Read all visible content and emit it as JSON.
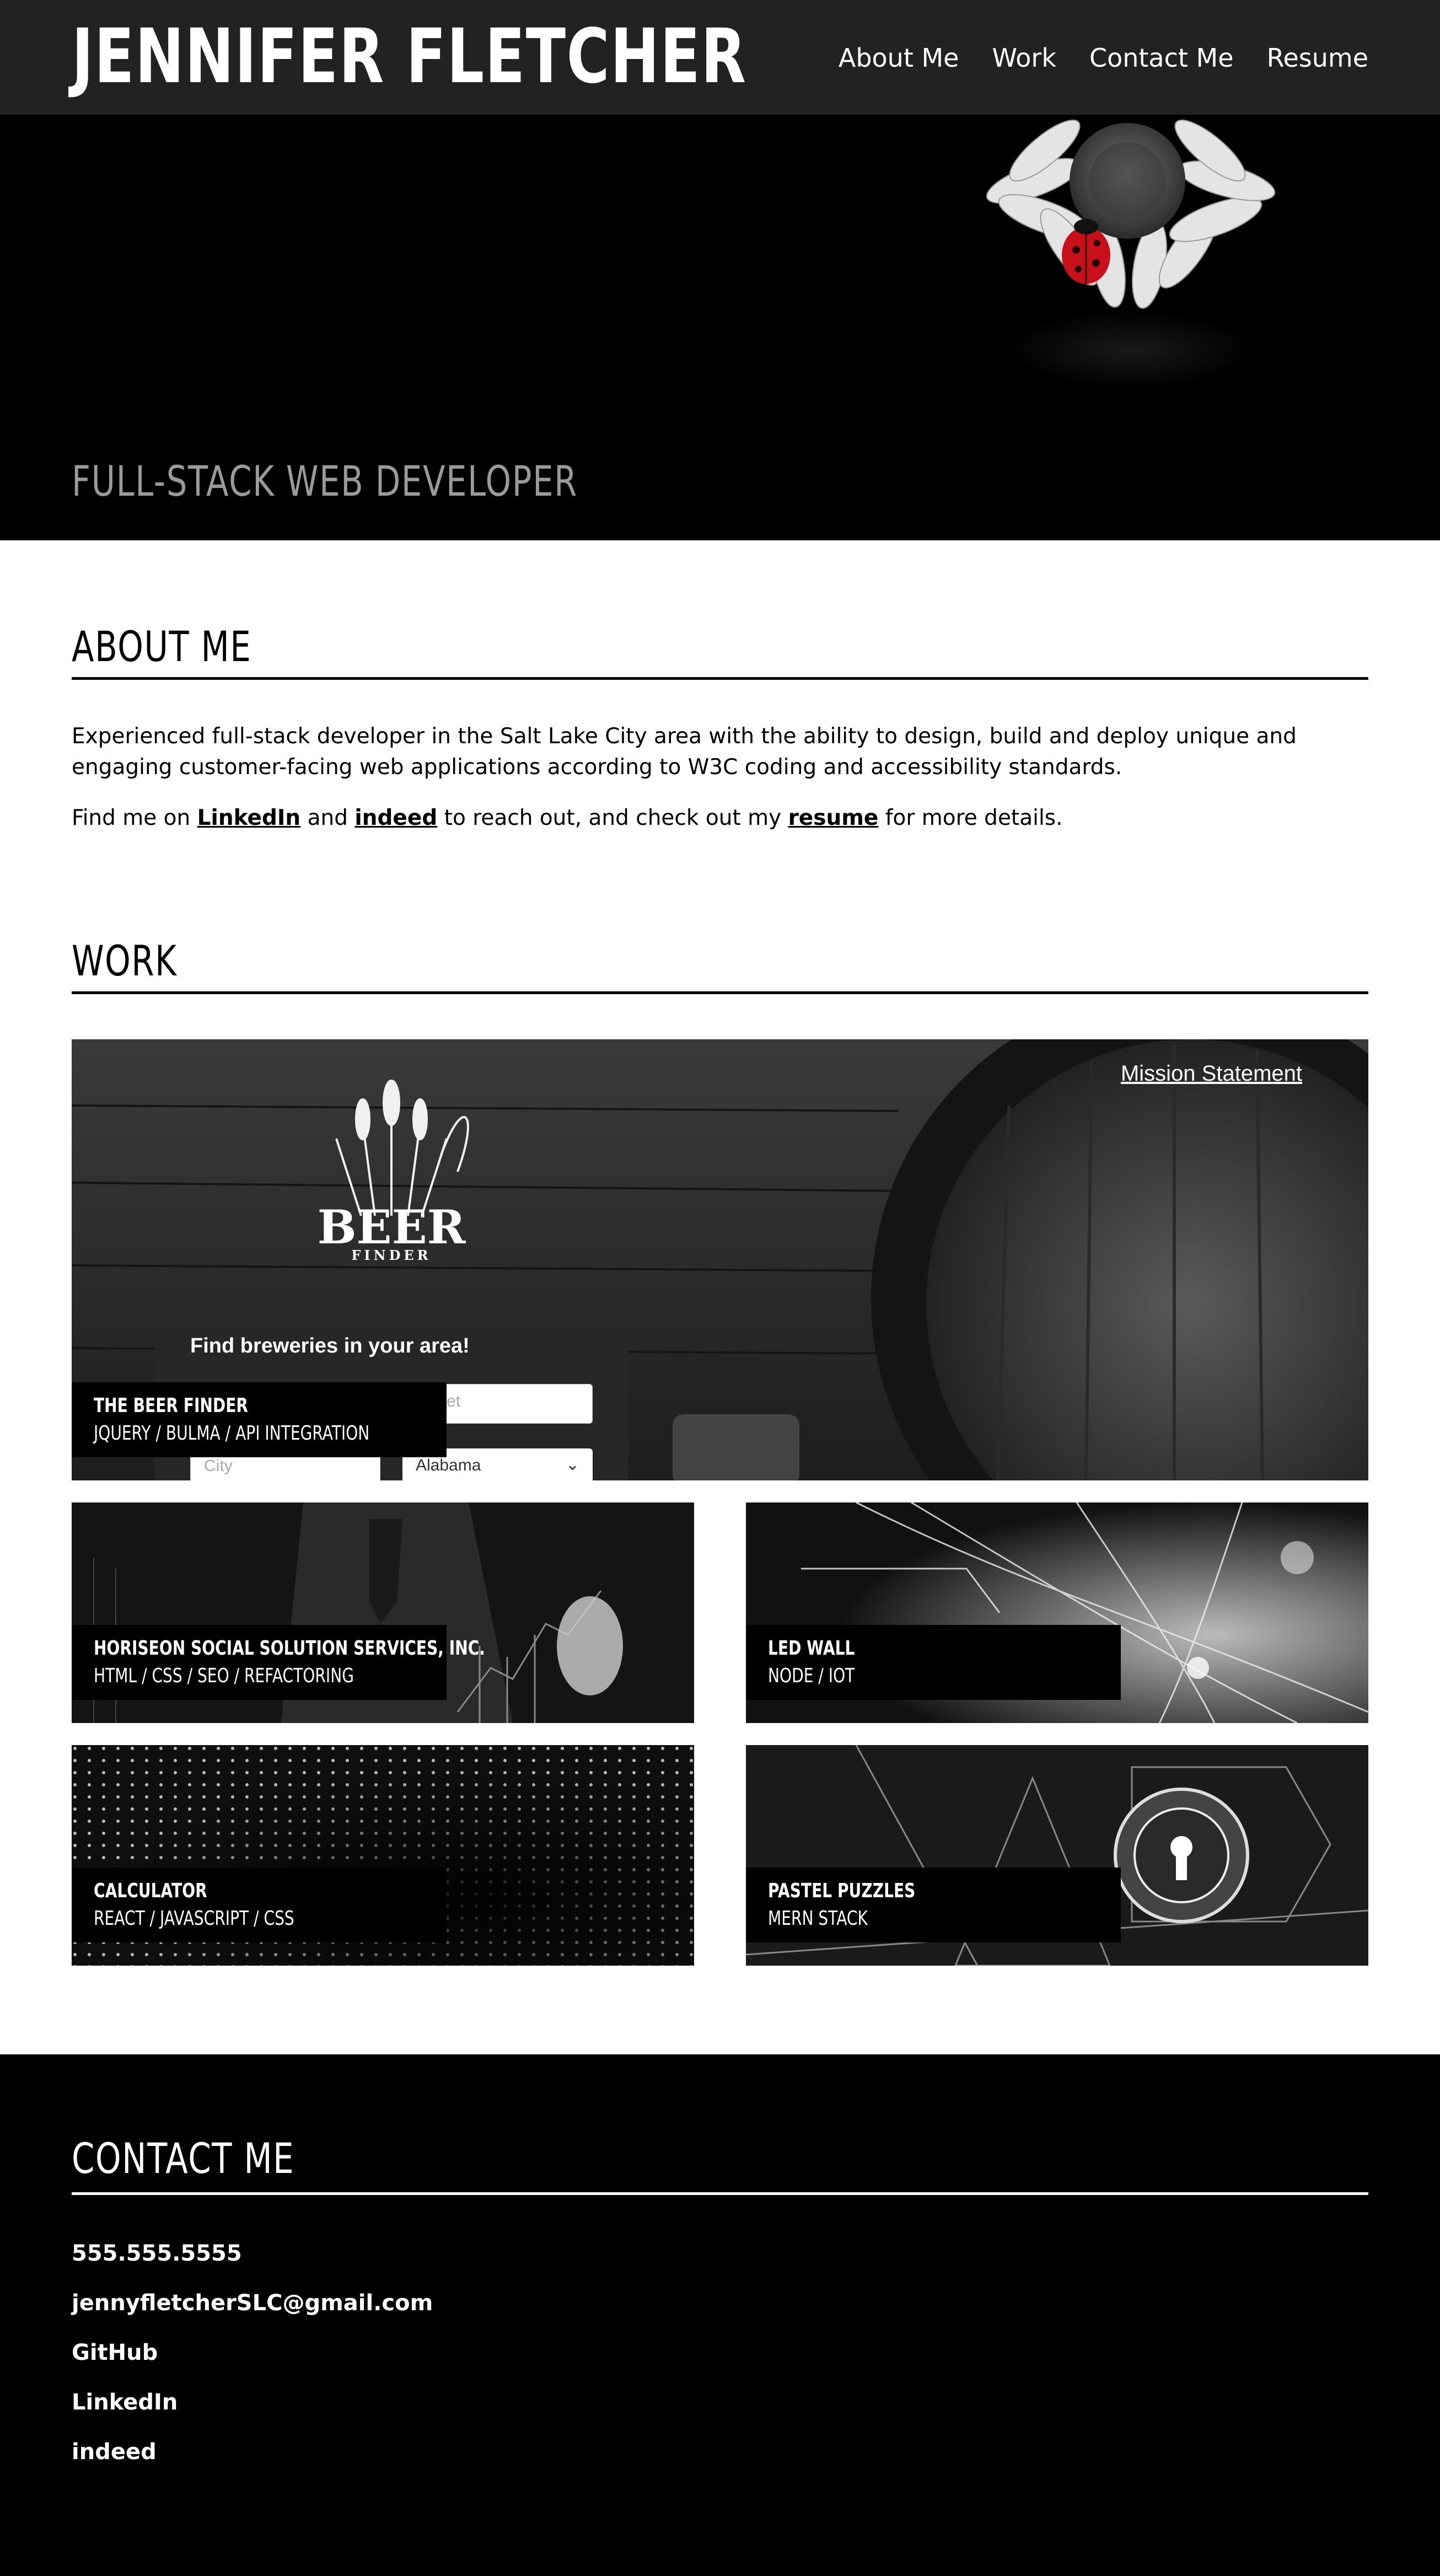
{
  "header": {
    "brand": "JENNIFER FLETCHER",
    "nav": [
      "About Me",
      "Work",
      "Contact Me",
      "Resume"
    ]
  },
  "hero": {
    "subtitle": "FULL-STACK WEB DEVELOPER"
  },
  "about": {
    "heading": "ABOUT ME",
    "paragraph1": "Experienced full-stack developer in the Salt Lake City area with the ability to design, build and deploy unique and engaging customer-facing web applications according to W3C coding and accessibility standards.",
    "p2_prefix": "Find me on ",
    "p2_link1": "LinkedIn",
    "p2_and": " and ",
    "p2_link2": "indeed",
    "p2_middle": " to reach out, and check out my ",
    "p2_link3": "resume",
    "p2_suffix": " for more details."
  },
  "work": {
    "heading": "WORK",
    "featured": {
      "title": "THE BEER FINDER",
      "tech": "JQUERY / BULMA / API INTEGRATION",
      "mission_link": "Mission Statement",
      "logo_text": "BEER",
      "logo_sub": "FINDER",
      "panel_title": "Find breweries in your area!",
      "street_placeholder": "Street",
      "city_placeholder": "City",
      "state_selected": "Alabama"
    },
    "projects": [
      {
        "title": "HORISEON SOCIAL SOLUTION SERVICES, INC.",
        "tech": "HTML / CSS / SEO / REFACTORING"
      },
      {
        "title": "LED WALL",
        "tech": "NODE / IOT"
      },
      {
        "title": "CALCULATOR",
        "tech": "REACT / JAVASCRIPT / CSS"
      },
      {
        "title": "PASTEL PUZZLES",
        "tech": "MERN STACK"
      }
    ]
  },
  "contact": {
    "heading": "CONTACT ME",
    "phone": "555.555.5555",
    "email": "jennyfletcherSLC@gmail.com",
    "links": [
      "GitHub",
      "LinkedIn",
      "indeed"
    ]
  },
  "colors": {
    "header_bg": "#222222",
    "hero_bg": "#000000",
    "subtitle": "#9a9a9a",
    "ladybug": "#c8101a"
  }
}
